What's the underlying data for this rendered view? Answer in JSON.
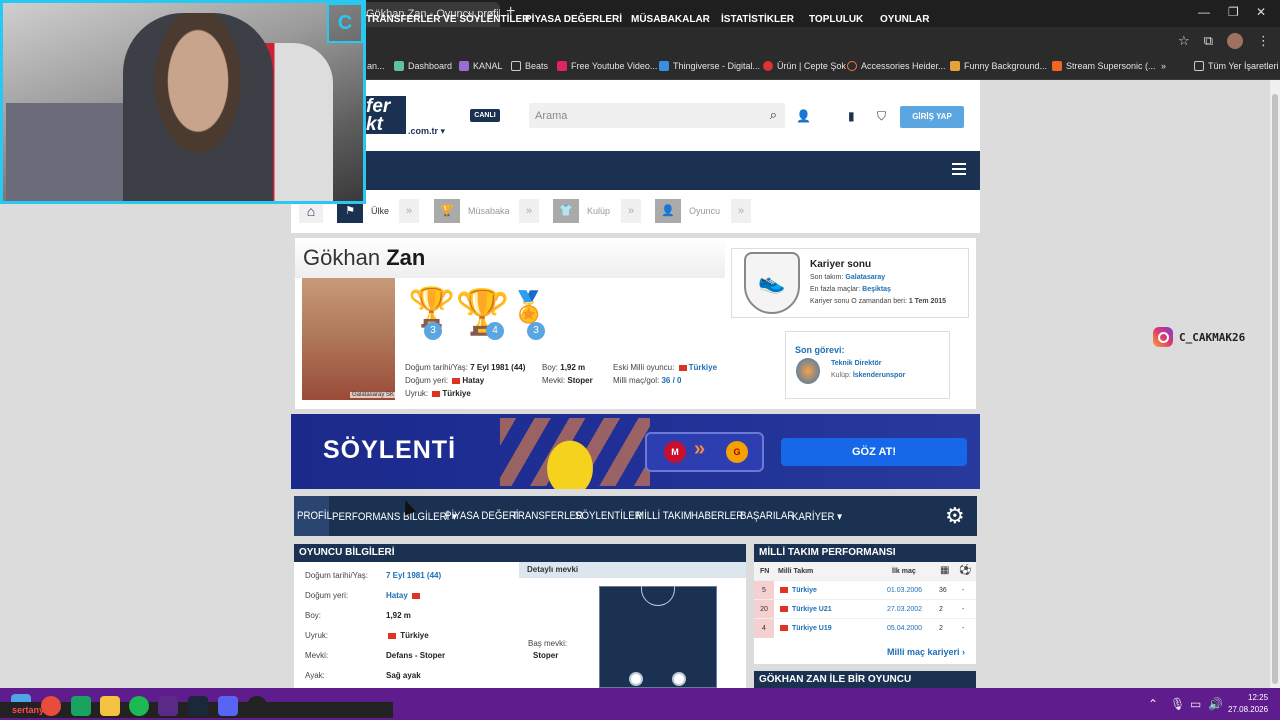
{
  "browser": {
    "tab_title": "Gökhan Zan - Oyuncu profili | T",
    "tab_close": "×",
    "new_tab": "+",
    "bookmarks": [
      "an...",
      "Dashboard",
      "KANAL",
      "Beats",
      "Free Youtube Video...",
      "Thingiverse - Digital...",
      "Ürün | Cepte Şok",
      "Accessories Heider...",
      "Funny Background...",
      "Stream Supersonic (...",
      "»",
      "Tüm Yer İşaretleri"
    ],
    "window_controls": [
      "—",
      "❐",
      "✕"
    ]
  },
  "header": {
    "logo_text": "fer\nkt",
    "logo_tld": ".com.tr ▾",
    "live_badge": "CANLI",
    "search_placeholder": "Arama",
    "login_label": "GİRİŞ YAP"
  },
  "mainnav": [
    "TRANSFERLER VE SÖYLENTİLER",
    "PİYASA DEĞERLERİ",
    "MÜSABAKALAR",
    "İSTATİSTİKLER",
    "TOPLULUK",
    "OYUNLAR"
  ],
  "filters": [
    {
      "label": "Ülke",
      "icon": "flag-icon"
    },
    {
      "label": "Müsabaka",
      "icon": "trophy-icon"
    },
    {
      "label": "Kulüp",
      "icon": "shirt-icon"
    },
    {
      "label": "Oyuncu",
      "icon": "person-icon"
    }
  ],
  "player": {
    "first_name": "Gökhan",
    "last_name": "Zan",
    "photo_caption": "Galatasaray SK",
    "trophy_counts": [
      "3",
      "4",
      "3"
    ],
    "birth_label": "Doğum tarihi/Yaş:",
    "birth_value": "7 Eyl 1981 (44)",
    "birthplace_label": "Doğum yeri:",
    "birthplace_value": "Hatay",
    "citizenship_label": "Uyruk:",
    "citizenship_value": "Türkiye",
    "height_label": "Boy:",
    "height_value": "1,92 m",
    "position_label": "Mevki:",
    "position_value": "Stoper",
    "former_intl_label": "Eski Milli oyuncu:",
    "former_intl_value": "Türkiye",
    "caps_label": "Milli maç/gol:",
    "caps_value": "36 / 0"
  },
  "career": {
    "title": "Kariyer sonu",
    "last_club_label": "Son takım:",
    "last_club_value": "Galatasaray",
    "most_games_label": "En fazla maçlar:",
    "most_games_value": "Beşiktaş",
    "retired_label": "Kariyer sonu O zamandan beri:",
    "retired_value": "1 Tem 2015"
  },
  "last_role": {
    "title": "Son görevi:",
    "role": "Teknik Direktör",
    "club_label": "Kulüp:",
    "club_value": "İskenderunspor"
  },
  "banner": {
    "title": "SÖYLENTİ",
    "arrows": "»",
    "cta": "GÖZ AT!"
  },
  "subnav": [
    "PROFİL",
    "PERFORMANS BİLGİLERİ ▾",
    "PİYASA DEĞERİ",
    "TRANSFERLER",
    "SÖYLENTİLER",
    "MİLLİ TAKIM",
    "HABERLER",
    "BAŞARILAR",
    "KARİYER ▾"
  ],
  "player_info": {
    "title": "OYUNCU BİLGİLERİ",
    "rows": [
      {
        "label": "Doğum tarihi/Yaş:",
        "value": "7 Eyl 1981 (44)"
      },
      {
        "label": "Doğum yeri:",
        "value": "Hatay"
      },
      {
        "label": "Boy:",
        "value": "1,92 m"
      },
      {
        "label": "Uyruk:",
        "value": "Türkiye"
      },
      {
        "label": "Mevki:",
        "value": "Defans - Stoper"
      },
      {
        "label": "Ayak:",
        "value": "Sağ ayak"
      }
    ],
    "detail_title": "Detaylı mevki",
    "main_position_label": "Baş mevki:",
    "main_position_value": "Stoper"
  },
  "national_team": {
    "title": "MİLLİ TAKIM PERFORMANSI",
    "col_fn": "FN",
    "col_team": "Milli Takım",
    "col_first": "İlk maç",
    "rows": [
      {
        "fn": "5",
        "team": "Türkiye",
        "date": "01.03.2006",
        "apps": "36",
        "goals": "-"
      },
      {
        "fn": "20",
        "team": "Türkiye U21",
        "date": "27.03.2002",
        "apps": "2",
        "goals": "-"
      },
      {
        "fn": "4",
        "team": "Türkiye U19",
        "date": "05.04.2000",
        "apps": "2",
        "goals": "-"
      }
    ],
    "link": "Milli maç kariyeri ›"
  },
  "compare_title": "GÖKHAN ZAN İLE BİR OYUNCU KARŞILAŞTIR",
  "overlay": {
    "cam_logo": "C",
    "instagram": "C_CAKMAK26"
  },
  "taskbar": {
    "stream_name": "sertanyas",
    "time": "12:25",
    "date": "27.08.2026"
  }
}
